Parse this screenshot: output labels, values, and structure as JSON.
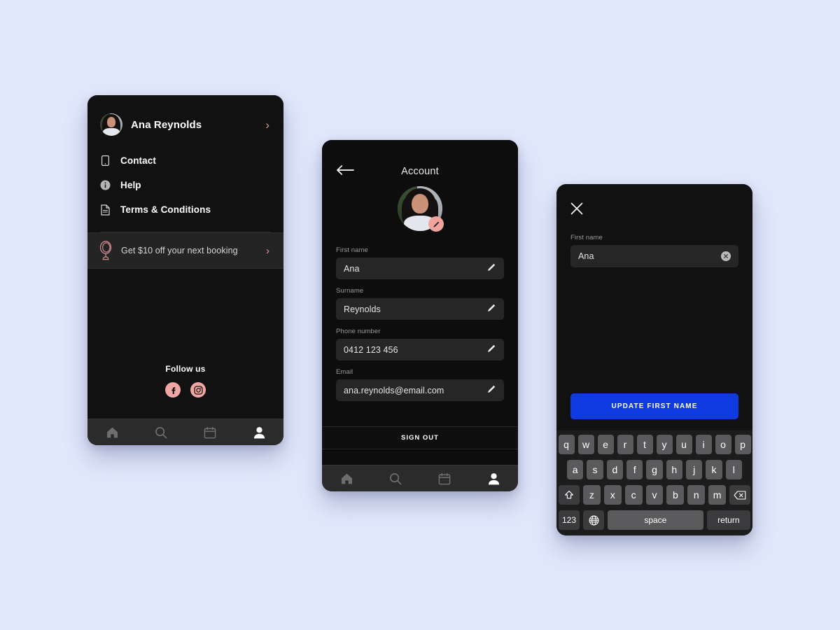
{
  "theme": {
    "page_background": "#e2e8fc",
    "phone_background": "#0d0d0d",
    "accent_pink": "#f2a7a4",
    "accent_blue": "#0f3ae0",
    "chevron_color": "#e09a94"
  },
  "menu_screen": {
    "profile": {
      "name": "Ana Reynolds",
      "avatar_icon": "user-avatar-photo",
      "chevron": "›"
    },
    "items": [
      {
        "label": "Contact",
        "icon": "phone-icon"
      },
      {
        "label": "Help",
        "icon": "info-circle-icon"
      },
      {
        "label": "Terms & Conditions",
        "icon": "document-icon"
      }
    ],
    "promo": {
      "label": "Get $10 off your next booking",
      "icon": "hand-mirror-icon",
      "chevron": "›"
    },
    "follow": {
      "title": "Follow us",
      "socials": [
        {
          "name": "facebook-icon",
          "glyph": "f"
        },
        {
          "name": "instagram-icon",
          "glyph": "instagram"
        }
      ]
    },
    "bottom_nav": [
      {
        "name": "home-icon",
        "active": false
      },
      {
        "name": "search-icon",
        "active": false
      },
      {
        "name": "calendar-icon",
        "active": false
      },
      {
        "name": "profile-icon",
        "active": true
      }
    ]
  },
  "account_screen": {
    "back_icon": "back-arrow-icon",
    "title": "Account",
    "avatar_icon": "user-avatar-photo",
    "edit_badge_icon": "pencil-icon",
    "fields": [
      {
        "label": "First name",
        "value": "Ana",
        "edit_icon": "pencil-icon"
      },
      {
        "label": "Surname",
        "value": "Reynolds",
        "edit_icon": "pencil-icon"
      },
      {
        "label": "Phone number",
        "value": "0412 123 456",
        "edit_icon": "pencil-icon"
      },
      {
        "label": "Email",
        "value": "ana.reynolds@email.com",
        "edit_icon": "pencil-icon"
      }
    ],
    "sign_out_label": "SIGN OUT",
    "bottom_nav": [
      {
        "name": "home-icon",
        "active": false
      },
      {
        "name": "search-icon",
        "active": false
      },
      {
        "name": "calendar-icon",
        "active": false
      },
      {
        "name": "profile-icon",
        "active": true
      }
    ]
  },
  "edit_screen": {
    "close_icon": "close-x-icon",
    "field": {
      "label": "First name",
      "value": "Ana",
      "placeholder": "First name",
      "clear_icon": "clear-circle-icon"
    },
    "update_button_label": "UPDATE FIRST NAME",
    "keyboard": {
      "row1": [
        "q",
        "w",
        "e",
        "r",
        "t",
        "y",
        "u",
        "i",
        "o",
        "p"
      ],
      "row2": [
        "a",
        "s",
        "d",
        "f",
        "g",
        "h",
        "j",
        "k",
        "l"
      ],
      "row3_shift": "shift-icon",
      "row3": [
        "z",
        "x",
        "c",
        "v",
        "b",
        "n",
        "m"
      ],
      "row3_backspace": "backspace-icon",
      "row4_numbers": "123",
      "row4_globe": "globe-icon",
      "row4_space": "space",
      "row4_return": "return"
    }
  }
}
